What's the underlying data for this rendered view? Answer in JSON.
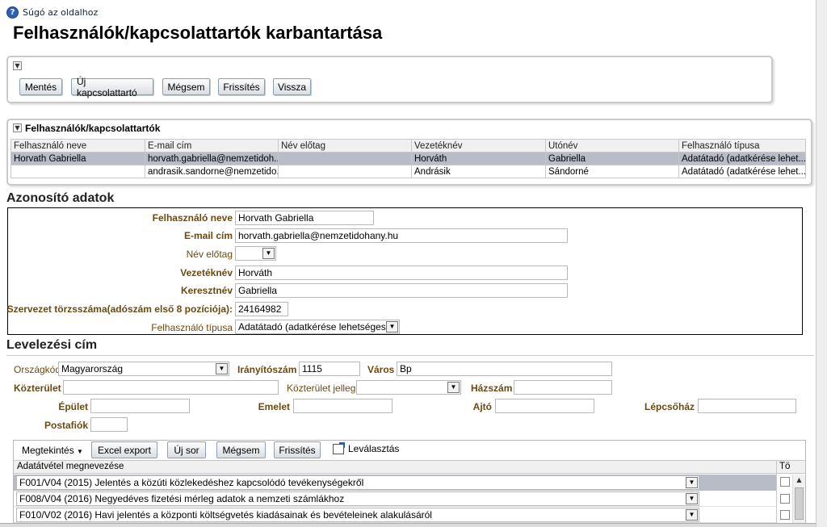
{
  "help_link": "Súgó az oldalhoz",
  "page_title": "Felhasználók/kapcsolattartók karbantartása",
  "toolbar": {
    "save": "Mentés",
    "new_contact": "Új kapcsolattartó",
    "cancel": "Mégsem",
    "refresh": "Frissítés",
    "back": "Vissza"
  },
  "users_panel": {
    "title": "Felhasználók/kapcsolattartók",
    "columns": [
      "Felhasználó neve",
      "E-mail cím",
      "Név előtag",
      "Vezetéknév",
      "Utónév",
      "Felhasználó típusa"
    ],
    "rows": [
      [
        "Horvath Gabriella",
        "horvath.gabriella@nemzetidoh...",
        "",
        "Horváth",
        "Gabriella",
        "Adatátadó (adatkérése lehet..."
      ],
      [
        "",
        "andrasik.sandorne@nemzetido...",
        "",
        "Andrásik",
        "Sándorné",
        "Adatátadó (adatkérése lehet..."
      ]
    ]
  },
  "identity": {
    "section_title": "Azonosító adatok",
    "username_label": "Felhasználó neve",
    "username_value": "Horvath Gabriella",
    "email_label": "E-mail cím",
    "email_value": "horvath.gabriella@nemzetidohany.hu",
    "prefix_label": "Név előtag",
    "prefix_value": "",
    "lastname_label": "Vezetéknév",
    "lastname_value": "Horváth",
    "firstname_label": "Keresztnév",
    "firstname_value": "Gabriella",
    "orgid_label": "Szervezet törzsszáma(adószám első 8 pozíciója):",
    "orgid_value": "24164982",
    "usertype_label": "Felhasználó típusa",
    "usertype_value": "Adatátadó (adatkérése lehetséges)"
  },
  "address": {
    "section_title": "Levelezési cím",
    "country_label": "Országkód",
    "country_value": "Magyarország",
    "zip_label": "Irányítószám",
    "zip_value": "1115",
    "city_label": "Város",
    "city_value": "Bp",
    "street_label": "Közterület",
    "street_value": "",
    "street_type_label": "Közterület jellege",
    "street_type_value": "",
    "house_label": "Házszám",
    "house_value": "",
    "building_label": "Épület",
    "building_value": "",
    "floor_label": "Emelet",
    "floor_value": "",
    "door_label": "Ajtó",
    "door_value": "",
    "stair_label": "Lépcsőház",
    "stair_value": "",
    "pobox_label": "Postafiók",
    "pobox_value": ""
  },
  "data_table": {
    "view_menu": "Megtekintés",
    "excel_export": "Excel export",
    "new_row": "Új sor",
    "cancel": "Mégsem",
    "refresh": "Frissítés",
    "detach": "Leválasztás",
    "col_name": "Adatátvétel megnevezése",
    "col_delete": "Tö",
    "rows": [
      "F001/V04 (2015) Jelentés a közúti közlekedéshez kapcsolódó tevékenységekről",
      "F008/V04 (2016) Negyedéves fizetési mérleg adatok a nemzeti számlákhoz",
      "F010/V02 (2016) Havi jelentés a központi költségvetés kiadásainak és bevételeinek alakulásáról"
    ]
  },
  "colors": {
    "label_brown": "#6b4a10",
    "selected_row": "#b7bcc7",
    "help_icon_blue": "#2f5fb3"
  }
}
